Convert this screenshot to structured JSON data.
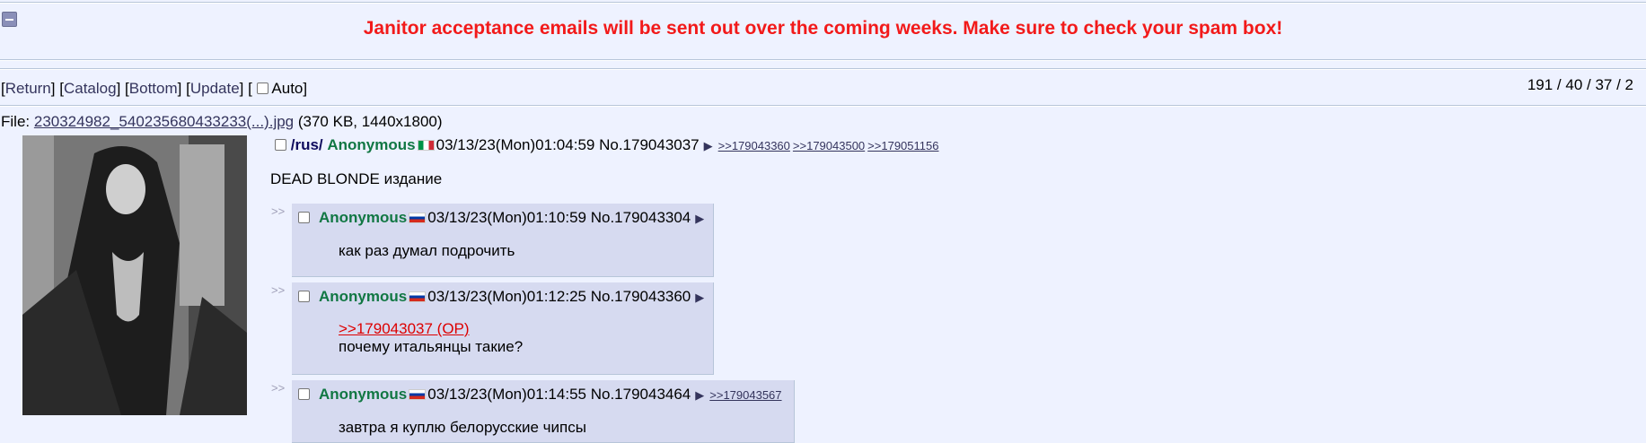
{
  "announcement": "Janitor acceptance emails will be sent out over the coming weeks. Make sure to check your spam box!",
  "nav": {
    "return": "Return",
    "catalog": "Catalog",
    "bottom": "Bottom",
    "update": "Update",
    "auto": "Auto",
    "open": "[",
    "close": "]"
  },
  "stats": "191 / 40 / 37 / 2",
  "file": {
    "prefix": "File:",
    "name": "230324982_540235680433233(...).jpg",
    "meta": "(370 KB, 1440x1800)"
  },
  "op": {
    "board": "/rus/",
    "name": "Anonymous",
    "flag": "Italy",
    "datetime": "03/13/23(Mon)01:04:59",
    "number": "No.179043037",
    "backlinks": [
      ">>179043360",
      ">>179043500",
      ">>179051156"
    ],
    "comment": "DEAD BLONDE издание"
  },
  "replies": [
    {
      "name": "Anonymous",
      "flag": "Russia",
      "datetime": "03/13/23(Mon)01:10:59",
      "number": "No.179043304",
      "lines": [
        "как раз думал подрочить"
      ]
    },
    {
      "name": "Anonymous",
      "flag": "Russia",
      "datetime": "03/13/23(Mon)01:12:25",
      "number": "No.179043360",
      "quote": ">>179043037 (OP)",
      "lines": [
        "почему итальянцы такие?"
      ]
    },
    {
      "name": "Anonymous",
      "flag": "Russia",
      "datetime": "03/13/23(Mon)01:14:55",
      "number": "No.179043464",
      "backlink": ">>179043567",
      "lines": [
        "завтра я куплю белорусские чипсы"
      ]
    }
  ],
  "glyphs": {
    "menu": "▶",
    "sidearrow": ">>"
  },
  "colors": {
    "announcement": "#f21a1a",
    "name": "#117743",
    "reply_bg": "#d6daf0",
    "page_bg": "#eef2ff"
  }
}
